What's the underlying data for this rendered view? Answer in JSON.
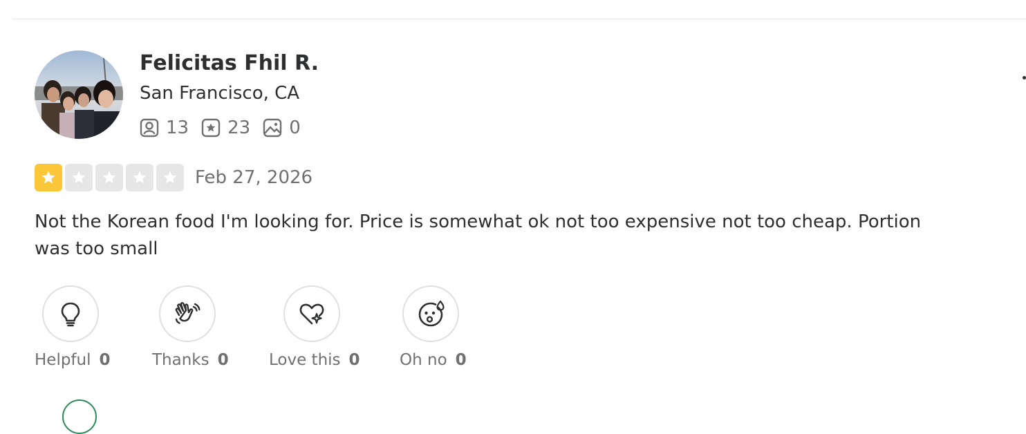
{
  "review": {
    "user": {
      "name": "Felicitas Fhil R.",
      "location": "San Francisco, CA",
      "stats": {
        "friends": "13",
        "reviews": "23",
        "photos": "0"
      }
    },
    "rating": 1,
    "rating_max": 5,
    "date": "Feb 27, 2026",
    "text": "Not the Korean food I'm looking for. Price is somewhat ok not too expensive not too cheap. Portion was too small",
    "reactions": [
      {
        "label": "Helpful",
        "count": "0",
        "icon": "lightbulb-icon"
      },
      {
        "label": "Thanks",
        "count": "0",
        "icon": "waving-hands-icon"
      },
      {
        "label": "Love this",
        "count": "0",
        "icon": "heart-sparkle-icon"
      },
      {
        "label": "Oh no",
        "count": "0",
        "icon": "surprised-face-icon"
      }
    ]
  },
  "colors": {
    "star_filled": "#fbc638",
    "star_empty": "#e6e6e6",
    "text_primary": "#2d2e2f",
    "text_secondary": "#6e7072"
  }
}
